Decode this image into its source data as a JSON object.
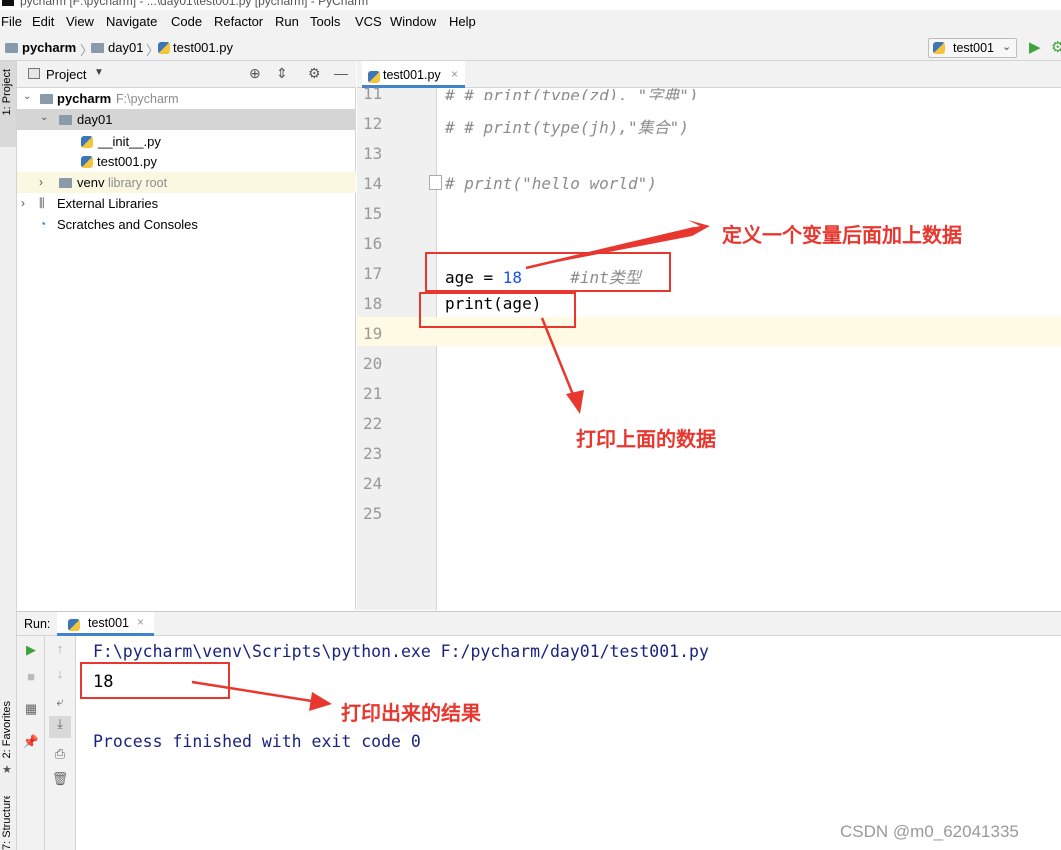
{
  "window": {
    "title": "pycharm [F:\\pycharm] - ...\\day01\\test001.py [pycharm] - PyCharm"
  },
  "menu": [
    "File",
    "Edit",
    "View",
    "Navigate",
    "Code",
    "Refactor",
    "Run",
    "Tools",
    "VCS",
    "Window",
    "Help"
  ],
  "breadcrumb": {
    "project": "pycharm",
    "folder": "day01",
    "file": "test001.py"
  },
  "run_config": {
    "label": "test001"
  },
  "left_strip": {
    "project_tab": "1: Project",
    "favorites_tab": "2: Favorites",
    "structure_tab": "7: Structure"
  },
  "project_panel": {
    "header": "Project",
    "tree": [
      {
        "label": "pycharm",
        "hint": "F:\\pycharm"
      },
      {
        "label": "day01"
      },
      {
        "label": "__init__.py"
      },
      {
        "label": "test001.py"
      },
      {
        "label": "venv",
        "hint": "library root"
      },
      {
        "label": "External Libraries"
      },
      {
        "label": "Scratches and Consoles"
      }
    ]
  },
  "editor": {
    "tab": "test001.py",
    "line_numbers": [
      "11",
      "12",
      "13",
      "14",
      "15",
      "16",
      "17",
      "18",
      "19",
      "20",
      "21",
      "22",
      "23",
      "24",
      "25"
    ],
    "lines": {
      "l11": "# # print(type(zd), \"字典\")",
      "l12": "# # print(type(jh),\"集合\")",
      "l14": "# print(\"hello world\")",
      "l17_a": "age = ",
      "l17_num": "18",
      "l17_cmt": "#int类型",
      "l18": "print(age)"
    }
  },
  "run_panel": {
    "label": "Run:",
    "tab": "test001",
    "output": [
      "F:\\pycharm\\venv\\Scripts\\python.exe F:/pycharm/day01/test001.py",
      "18",
      "Process finished with exit code 0"
    ]
  },
  "annotations": {
    "a1": "定义一个变量后面加上数据",
    "a2": "打印上面的数据",
    "a3": "打印出来的结果"
  },
  "watermark": "CSDN @m0_62041335",
  "colors": {
    "annotation_red": "#e8372f",
    "comment_grey": "#8c8c8c",
    "number_blue": "#1750eb",
    "console_blue": "#1a237e"
  }
}
